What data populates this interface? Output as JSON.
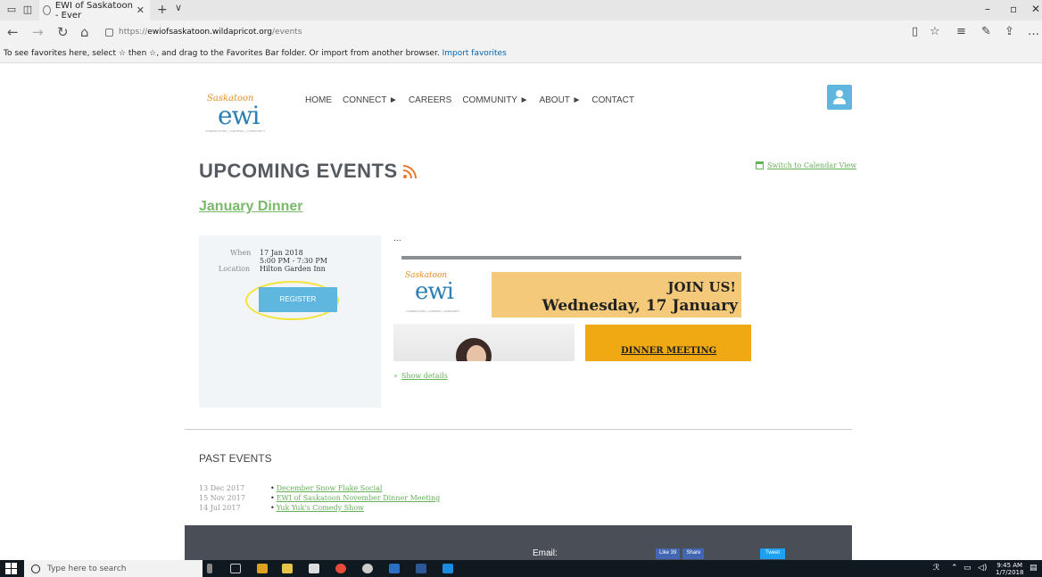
{
  "browser": {
    "tab_title": "EWI of Saskatoon - Ever",
    "url_proto": "https://",
    "url_host": "ewiofsaskatoon.wildapricot.org",
    "url_path": "/events",
    "favbar_text": "To see favorites here, select ☆ then ☆, and drag to the Favorites Bar folder. Or import from another browser.",
    "favbar_link": "Import favorites"
  },
  "site": {
    "logo_script": "Saskatoon",
    "logo_text": "ewi",
    "logo_tagline": "CONNECTIONS | CAREERS | COMMUNITY",
    "nav": [
      "HOME",
      "CONNECT ►",
      "CAREERS",
      "COMMUNITY ►",
      "ABOUT ►",
      "CONTACT"
    ]
  },
  "events": {
    "heading": "UPCOMING EVENTS",
    "calendar_link": "Switch to Calendar View",
    "event_title": "January Dinner",
    "when_label": "When",
    "when_date": "17 Jan 2018",
    "when_time": "5:00 PM - 7:30 PM",
    "location_label": "Location",
    "location_value": "Hilton Garden Inn",
    "register_label": "REGISTER",
    "ellipsis": "...",
    "flyer_join": "JOIN US!",
    "flyer_date": "Wednesday, 17 January",
    "flyer_dinner": "DINNER MEETING",
    "show_details": "Show details"
  },
  "past": {
    "title": "PAST EVENTS",
    "items": [
      {
        "date": "13 Dec 2017",
        "name": "December Snow Flake Social"
      },
      {
        "date": "15 Nov 2017",
        "name": "EWI of Saskatoon November Dinner Meeting"
      },
      {
        "date": "14 Jul 2017",
        "name": "Yuk Yuk's Comedy Show"
      }
    ]
  },
  "footer": {
    "email_label": "Email:",
    "fb_like": "Like 39",
    "fb_share": "Share",
    "tweet": "Tweet"
  },
  "taskbar": {
    "search_placeholder": "Type here to search",
    "time": "9:45 AM",
    "date": "1/7/2018"
  },
  "colors": {
    "accent_blue": "#5fb7e0",
    "link_green": "#69b05b",
    "rss_orange": "#e8792e",
    "highlight_yellow": "#f3e33a"
  }
}
